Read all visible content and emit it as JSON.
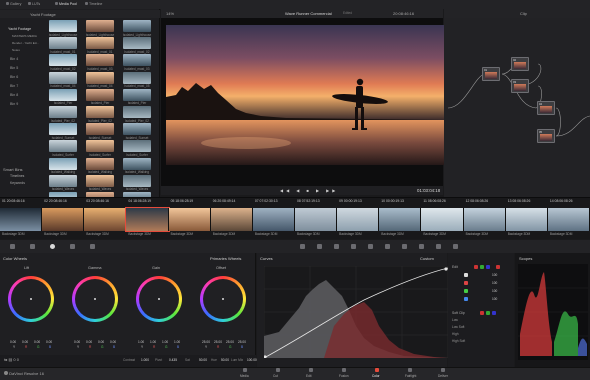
{
  "top_tabs": [
    "Gallery",
    "LUTs",
    "Media Pool",
    "Timeline"
  ],
  "media_pool": {
    "title": "Yacht Footage",
    "bins": [
      "Yacht Footage",
      "MASTERS MEDIA",
      "Render - Yacht Ed...",
      "Notes",
      "Bin 4",
      "Bin 5",
      "Bin 6",
      "Bin 7",
      "Bin 8",
      "Bin 9"
    ],
    "smart_bins_title": "Smart Bins",
    "smart_bins": [
      "Timelines",
      "Keywords"
    ],
    "thumbs": [
      "Isolated_Lighthouse",
      "Isolated_Lighthouse",
      "Isolated_Lighthouse",
      "Isolated_mast_01",
      "Isolated_mast_01",
      "Isolated_mast_02",
      "Isolated_mast_02",
      "Isolated_mast_03",
      "Isolated_mast_03",
      "Isolated_mast_04",
      "Isolated_mast_04",
      "Isolated_mast_05",
      "Isolated_Pier",
      "Isolated_Pier",
      "Isolated_Pier",
      "Isolated_Pier_02",
      "Isolated_Pier_02",
      "Isolated_Pier_02",
      "Isolated_Sunset",
      "Isolated_Sunset",
      "Isolated_Sunset",
      "Isolated_Surfer",
      "Isolated_Surfer",
      "Isolated_Surfer",
      "Isolated_Walking",
      "Isolated_Walking",
      "Isolated_Walking",
      "Isolated_Waves",
      "Isolated_Waves",
      "Isolated_Waves",
      "Isolated_Yacht",
      "Isolated_Yacht",
      "Isolated_Yacht"
    ]
  },
  "viewer": {
    "zoom": "14%",
    "title": "Wave Runner Commercial",
    "status": "Edited",
    "timecode_top": "20:08:46:16",
    "timecode": "01:03:04:18"
  },
  "node_panel": {
    "label": "Clip"
  },
  "timeline": {
    "clips": [
      {
        "num": "01",
        "tc": "20:08:46:16",
        "name": "Backstage 3DM"
      },
      {
        "num": "02",
        "tc": "20:08:46:16",
        "name": "Backstage 3DM"
      },
      {
        "num": "03",
        "tc": "20:08:46:16",
        "name": "Backstage 3DM"
      },
      {
        "num": "04",
        "tc": "18:06:28:19",
        "name": "Backstage 3DM"
      },
      {
        "num": "05",
        "tc": "18:06:28:19",
        "name": "Backstage 3DM"
      },
      {
        "num": "06",
        "tc": "20:08:49:14",
        "name": "Backstage 3DM"
      },
      {
        "num": "07",
        "tc": "07:02:30:13",
        "name": "Backstage 3DM"
      },
      {
        "num": "08",
        "tc": "07:52:19:13",
        "name": "Backstage 3DM"
      },
      {
        "num": "09",
        "tc": "00:00:19:13",
        "name": "Backstage 3DM"
      },
      {
        "num": "10",
        "tc": "00:00:19:13",
        "name": "Backstage 3DM"
      },
      {
        "num": "11",
        "tc": "08:06:08:26",
        "name": "Backstage 3DM"
      },
      {
        "num": "12",
        "tc": "08:06:08:26",
        "name": "Backstage 3DM"
      },
      {
        "num": "13",
        "tc": "08:06:08:26",
        "name": "Backstage 3DM"
      },
      {
        "num": "14",
        "tc": "08:06:08:26",
        "name": "Backstage 3DM"
      }
    ]
  },
  "color_wheels": {
    "title": "Color Wheels",
    "mode": "Primaries Wheels",
    "wheels": [
      {
        "label": "Lift",
        "values": [
          "0.00",
          "0.00",
          "0.00",
          "0.00"
        ]
      },
      {
        "label": "Gamma",
        "values": [
          "0.00",
          "0.00",
          "0.00",
          "0.00"
        ]
      },
      {
        "label": "Gain",
        "values": [
          "1.00",
          "1.00",
          "1.00",
          "1.00"
        ]
      },
      {
        "label": "Offset",
        "values": [
          "25.00",
          "25.00",
          "25.00",
          "25.00"
        ]
      }
    ],
    "footer": [
      "Contrast",
      "1.000",
      "Pivot",
      "0.435",
      "Sat",
      "50.00",
      "Hue",
      "50.00",
      "Lum Mix",
      "100.00"
    ]
  },
  "curves": {
    "title": "Curves",
    "mode": "Custom",
    "edit_label": "Edit",
    "rows": [
      "100",
      "100",
      "100",
      "100"
    ],
    "soft_clip": "Soft Clip",
    "soft_rows": [
      "Low",
      "Low Soft",
      "High",
      "High Soft"
    ]
  },
  "scopes": {
    "title": "Scopes"
  },
  "project": {
    "name": "DaVinci Resolve 16"
  },
  "pages": [
    "Media",
    "Cut",
    "Edit",
    "Fusion",
    "Color",
    "Fairlight",
    "Deliver"
  ],
  "active_page": "Color",
  "colors": {
    "accent": "#e64b3b",
    "panel": "#232326",
    "bg": "#1a1a1c"
  }
}
